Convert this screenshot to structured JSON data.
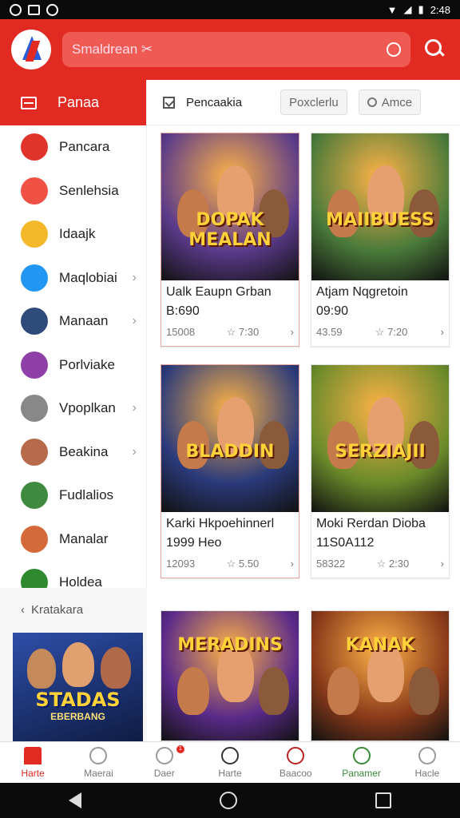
{
  "status": {
    "time": "2:48"
  },
  "header": {
    "search_placeholder": "Smaldrean ✂"
  },
  "sidebar": {
    "title": "Panaa",
    "items": [
      {
        "label": "Pancara",
        "color": "#e0332b",
        "chevron": false
      },
      {
        "label": "Senlehsia",
        "color": "#ef5144",
        "chevron": false
      },
      {
        "label": "Idaajk",
        "color": "#f4b82a",
        "chevron": false
      },
      {
        "label": "Maqlobiai",
        "color": "#2196f3",
        "chevron": true
      },
      {
        "label": "Manaan",
        "color": "#2e4b7a",
        "chevron": true
      },
      {
        "label": "Porlviake",
        "color": "#8e3fa8",
        "chevron": false
      },
      {
        "label": "Vpoplkan",
        "color": "#888888",
        "chevron": true
      },
      {
        "label": "Beakina",
        "color": "#b86b4a",
        "chevron": true
      },
      {
        "label": "Fudlalios",
        "color": "#3f8a3f",
        "chevron": false
      },
      {
        "label": "Manalar",
        "color": "#d46a3a",
        "chevron": false
      },
      {
        "label": "Holdea",
        "color": "#2f8a2f",
        "chevron": false
      }
    ]
  },
  "promo": {
    "title": "Kratakara",
    "game_title": "STADAS",
    "game_sub": "EBERBANG"
  },
  "filters": {
    "title": "Pencaakia",
    "chip": "Poxclerlu",
    "search_chip": "Amce"
  },
  "cards": [
    {
      "title": "Ualk Eaupn Grban",
      "price": "B:690",
      "meta": "15008",
      "rating": "7:30",
      "game": "DOPAK MEALAN",
      "bg": "#5a3a8a"
    },
    {
      "title": "Atjam Nqgretoin",
      "price": "09:90",
      "meta": "43.59",
      "rating": "7:20",
      "game": "MAIIBUESS",
      "bg": "#4a7a3a"
    },
    {
      "title": "Karki Hkpoehinnerl",
      "price": "1999 Heo",
      "meta": "12093",
      "rating": "5.50",
      "game": "BLADDIN",
      "bg": "#2a3a7a"
    },
    {
      "title": "Moki Rerdan Dioba",
      "price": "11S0A112",
      "meta": "58322",
      "rating": "2:30",
      "game": "SERZIAJII",
      "bg": "#6a8a2a"
    },
    {
      "title": "",
      "price": "",
      "meta": "",
      "rating": "",
      "game": "MERADINS",
      "bg": "#5a2a8a"
    },
    {
      "title": "",
      "price": "",
      "meta": "",
      "rating": "",
      "game": "KANAK",
      "bg": "#8a3a1a"
    }
  ],
  "nav": [
    {
      "label": "Harte",
      "state": "active"
    },
    {
      "label": "Maerai",
      "state": ""
    },
    {
      "label": "Daer",
      "state": "",
      "badge": "1"
    },
    {
      "label": "Harte",
      "state": ""
    },
    {
      "label": "Baacoo",
      "state": ""
    },
    {
      "label": "Panamer",
      "state": "green"
    },
    {
      "label": "Hacle",
      "state": ""
    }
  ]
}
